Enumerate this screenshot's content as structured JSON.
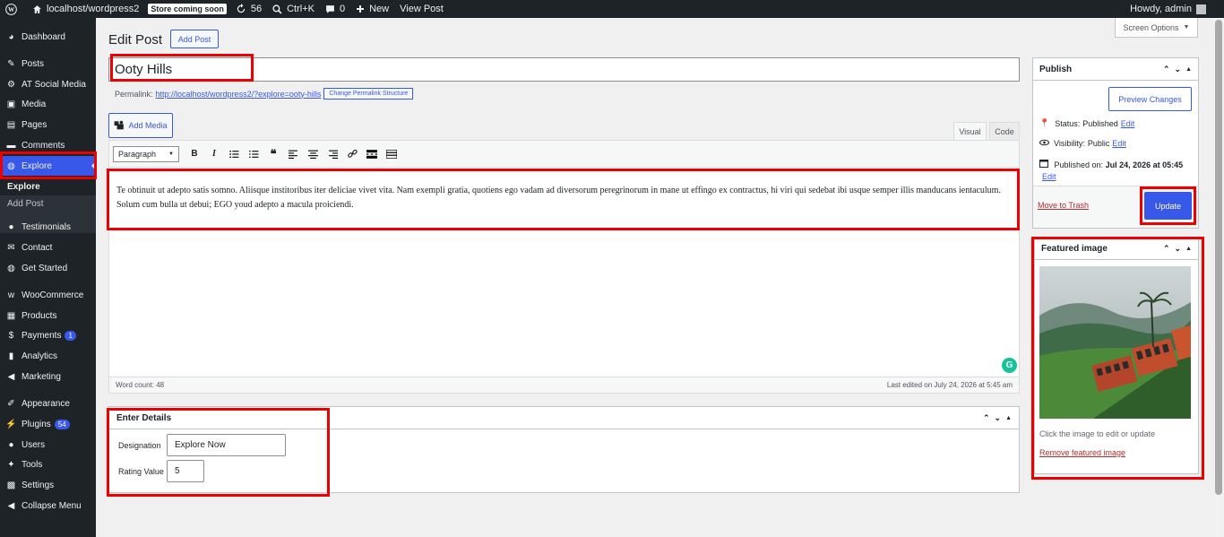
{
  "adminbar": {
    "site": "localhost/wordpress2",
    "store_badge": "Store coming soon",
    "updates": "56",
    "search": "Ctrl+K",
    "comments": "0",
    "new": "New",
    "view_post": "View Post",
    "howdy": "Howdy, admin"
  },
  "sidebar": {
    "items": [
      {
        "label": "Dashboard",
        "icon": "dashboard-icon"
      },
      {
        "label": "Posts",
        "icon": "pin-icon"
      },
      {
        "label": "AT Social Media",
        "icon": "gear-icon"
      },
      {
        "label": "Media",
        "icon": "media-icon"
      },
      {
        "label": "Pages",
        "icon": "page-icon"
      },
      {
        "label": "Comments",
        "icon": "comment-icon"
      },
      {
        "label": "Explore",
        "icon": "globe-icon"
      },
      {
        "label": "Testimonials",
        "icon": "user-icon"
      },
      {
        "label": "Contact",
        "icon": "mail-icon"
      },
      {
        "label": "Get Started",
        "icon": "globe-icon"
      },
      {
        "label": "WooCommerce",
        "icon": "woo-icon"
      },
      {
        "label": "Products",
        "icon": "archive-icon"
      },
      {
        "label": "Payments",
        "icon": "dollar-icon",
        "badge": "1"
      },
      {
        "label": "Analytics",
        "icon": "chart-icon"
      },
      {
        "label": "Marketing",
        "icon": "megaphone-icon"
      },
      {
        "label": "Appearance",
        "icon": "brush-icon"
      },
      {
        "label": "Plugins",
        "icon": "plug-icon",
        "badge": "54"
      },
      {
        "label": "Users",
        "icon": "user-icon"
      },
      {
        "label": "Tools",
        "icon": "wrench-icon"
      },
      {
        "label": "Settings",
        "icon": "settings-icon"
      },
      {
        "label": "Collapse Menu",
        "icon": "collapse-icon"
      }
    ],
    "submenu": [
      "Explore",
      "Add Post"
    ]
  },
  "header": {
    "title": "Edit Post",
    "add_post": "Add Post",
    "screen_options": "Screen Options"
  },
  "post": {
    "title": "Ooty Hills",
    "permalink_label": "Permalink:",
    "permalink_url": "http://localhost/wordpress2/?explore=ooty-hills",
    "permalink_btn": "Change Permalink Structure",
    "add_media": "Add Media",
    "tab_visual": "Visual",
    "tab_code": "Code",
    "format": "Paragraph",
    "content": "Te obtinuit ut adepto satis somno. Aliisque institoribus iter deliciae vivet vita. Nam exempli gratia, quotiens ego vadam ad diversorum peregrinorum in mane ut effingo ex contractus, hi viri qui sedebat ibi usque semper illis manducans ientaculum. Solum cum bulla ut debui; EGO youd adepto a macula proiciendi.",
    "word_count": "Word count: 48",
    "last_edited": "Last edited on July 24, 2026 at 5:45 am"
  },
  "details": {
    "title": "Enter Details",
    "designation_label": "Designation",
    "designation_value": "Explore Now",
    "rating_label": "Rating Value",
    "rating_value": "5"
  },
  "publish": {
    "title": "Publish",
    "preview": "Preview Changes",
    "status_label": "Status:",
    "status_value": "Published",
    "visibility_label": "Visibility:",
    "visibility_value": "Public",
    "published_label": "Published on:",
    "published_value": "Jul 24, 2026 at 05:45",
    "edit": "Edit",
    "trash": "Move to Trash",
    "update": "Update"
  },
  "featured": {
    "title": "Featured image",
    "hint": "Click the image to edit or update",
    "remove": "Remove featured image"
  }
}
